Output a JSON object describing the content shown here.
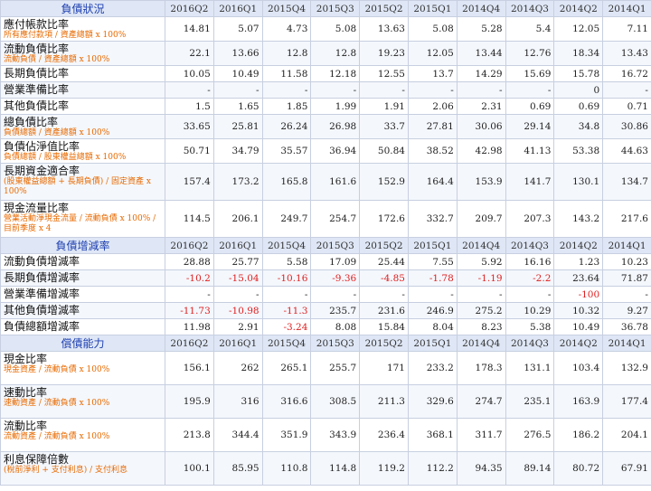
{
  "columns": [
    "2016Q2",
    "2016Q1",
    "2015Q4",
    "2015Q3",
    "2015Q2",
    "2015Q1",
    "2014Q4",
    "2014Q3",
    "2014Q2",
    "2014Q1"
  ],
  "sections": [
    {
      "title": "負債狀況",
      "rows": [
        {
          "name": "應付帳款比率",
          "sub": "所有應付款項 / 資產總額 x 100%",
          "size": "h2",
          "values": [
            "14.81",
            "5.07",
            "4.73",
            "5.08",
            "13.63",
            "5.08",
            "5.28",
            "5.4",
            "12.05",
            "7.11"
          ]
        },
        {
          "name": "流動負債比率",
          "sub": "流動負債 / 資產總額 x 100%",
          "size": "h2",
          "values": [
            "22.1",
            "13.66",
            "12.8",
            "12.8",
            "19.23",
            "12.05",
            "13.44",
            "12.76",
            "18.34",
            "13.43"
          ]
        },
        {
          "name": "長期負債比率",
          "sub": "",
          "size": "h1",
          "values": [
            "10.05",
            "10.49",
            "11.58",
            "12.18",
            "12.55",
            "13.7",
            "14.29",
            "15.69",
            "15.78",
            "16.72"
          ]
        },
        {
          "name": "營業準備比率",
          "sub": "",
          "size": "h1",
          "values": [
            "-",
            "-",
            "-",
            "-",
            "-",
            "-",
            "-",
            "-",
            "0",
            "-"
          ]
        },
        {
          "name": "其他負債比率",
          "sub": "",
          "size": "h1",
          "values": [
            "1.5",
            "1.65",
            "1.85",
            "1.99",
            "1.91",
            "2.06",
            "2.31",
            "0.69",
            "0.69",
            "0.71"
          ]
        },
        {
          "name": "總負債比率",
          "sub": "負債總額 / 資產總額 x 100%",
          "size": "h2",
          "values": [
            "33.65",
            "25.81",
            "26.24",
            "26.98",
            "33.7",
            "27.81",
            "30.06",
            "29.14",
            "34.8",
            "30.86"
          ]
        },
        {
          "name": "負債佔淨值比率",
          "sub": "負債總額 / 股東權益總額 x 100%",
          "size": "h2",
          "values": [
            "50.71",
            "34.79",
            "35.57",
            "36.94",
            "50.84",
            "38.52",
            "42.98",
            "41.13",
            "53.38",
            "44.63"
          ]
        },
        {
          "name": "長期資金適合率",
          "sub": "(股東權益總額 + 長期負債) / 固定資產 x 100%",
          "size": "h4",
          "values": [
            "157.4",
            "173.2",
            "165.8",
            "161.6",
            "152.9",
            "164.4",
            "153.9",
            "141.7",
            "130.1",
            "134.7"
          ]
        },
        {
          "name": "現金流量比率",
          "sub": "營業活動淨現金流量 / 流動負債 x 100% / 目前季度 x 4",
          "size": "h4",
          "values": [
            "114.5",
            "206.1",
            "249.7",
            "254.7",
            "172.6",
            "332.7",
            "209.7",
            "207.3",
            "143.2",
            "217.6"
          ]
        }
      ]
    },
    {
      "title": "負債增減率",
      "rows": [
        {
          "name": "流動負債增減率",
          "sub": "",
          "size": "h1",
          "values": [
            "28.88",
            "25.77",
            "5.58",
            "17.09",
            "25.44",
            "7.55",
            "5.92",
            "16.16",
            "1.23",
            "10.23"
          ]
        },
        {
          "name": "長期負債增減率",
          "sub": "",
          "size": "h1",
          "values": [
            "-10.2",
            "-15.04",
            "-10.16",
            "-9.36",
            "-4.85",
            "-1.78",
            "-1.19",
            "-2.2",
            "23.64",
            "71.87"
          ]
        },
        {
          "name": "營業準備增減率",
          "sub": "",
          "size": "h1",
          "values": [
            "-",
            "-",
            "-",
            "-",
            "-",
            "-",
            "-",
            "-",
            "-100",
            "-"
          ]
        },
        {
          "name": "其他負債增減率",
          "sub": "",
          "size": "h1",
          "values": [
            "-11.73",
            "-10.98",
            "-11.3",
            "235.7",
            "231.6",
            "246.9",
            "275.2",
            "10.29",
            "10.32",
            "9.27"
          ]
        },
        {
          "name": "負債總額增減率",
          "sub": "",
          "size": "h1",
          "values": [
            "11.98",
            "2.91",
            "-3.24",
            "8.08",
            "15.84",
            "8.04",
            "8.23",
            "5.38",
            "10.49",
            "36.78"
          ]
        }
      ]
    },
    {
      "title": "償債能力",
      "rows": [
        {
          "name": "現金比率",
          "sub": "現金資產 / 流動負債 x 100%",
          "size": "h3",
          "values": [
            "156.1",
            "262",
            "265.1",
            "255.7",
            "171",
            "233.2",
            "178.3",
            "131.1",
            "103.4",
            "132.9"
          ]
        },
        {
          "name": "速動比率",
          "sub": "速動資產 / 流動負債 x 100%",
          "size": "h3",
          "values": [
            "195.9",
            "316",
            "316.6",
            "308.5",
            "211.3",
            "329.6",
            "274.7",
            "235.1",
            "163.9",
            "177.4"
          ]
        },
        {
          "name": "流動比率",
          "sub": "流動資產 / 流動負債 x 100%",
          "size": "h3",
          "values": [
            "213.8",
            "344.4",
            "351.9",
            "343.9",
            "236.4",
            "368.1",
            "311.7",
            "276.5",
            "186.2",
            "204.1"
          ]
        },
        {
          "name": "利息保障倍數",
          "sub": "(稅前淨利 + 支付利息) / 支付利息",
          "size": "h3",
          "values": [
            "100.1",
            "85.95",
            "110.8",
            "114.8",
            "119.2",
            "112.2",
            "94.35",
            "89.14",
            "80.72",
            "67.91"
          ]
        }
      ]
    }
  ]
}
